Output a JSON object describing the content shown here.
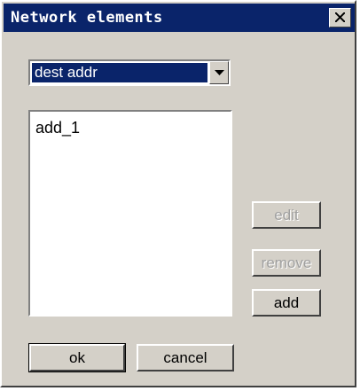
{
  "window": {
    "title": "Network elements"
  },
  "combo": {
    "selected": "dest addr"
  },
  "list": {
    "items": [
      "add_1"
    ]
  },
  "buttons": {
    "edit": "edit",
    "remove": "remove",
    "add": "add",
    "ok": "ok",
    "cancel": "cancel"
  },
  "colors": {
    "titlebar": "#0a246a",
    "face": "#d4d0c8"
  }
}
